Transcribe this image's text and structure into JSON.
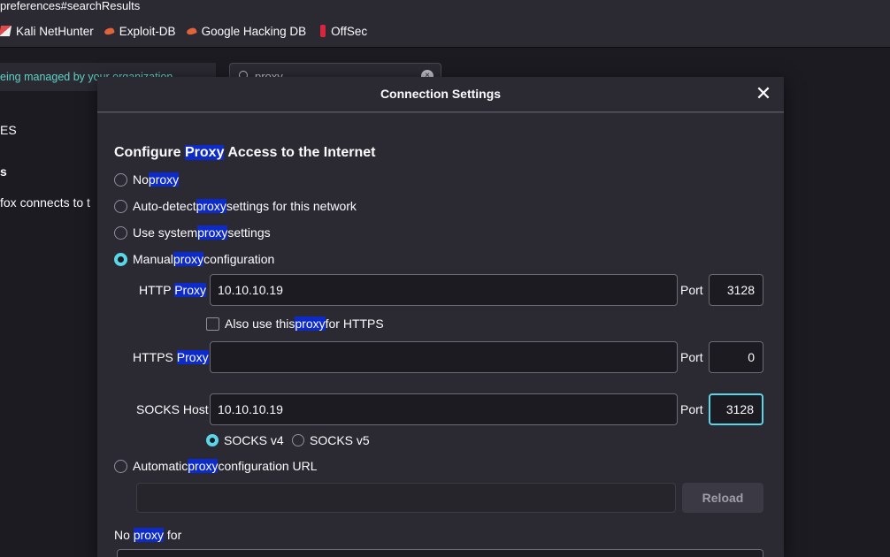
{
  "browser": {
    "url_fragment": "preferences#searchResults",
    "bookmarks": [
      {
        "label": "Kali NetHunter",
        "icon": "kali-icon"
      },
      {
        "label": "Exploit-DB",
        "icon": "exploit-db-icon"
      },
      {
        "label": "Google Hacking DB",
        "icon": "ghdb-icon"
      },
      {
        "label": "OffSec",
        "icon": "offsec-icon"
      }
    ]
  },
  "background": {
    "managed_notice": "eing managed by your organization",
    "search_value": "proxy",
    "side_1": "ES",
    "side_2": "s",
    "side_3": "fox connects to t"
  },
  "dialog": {
    "title": "Connection Settings",
    "heading_pre": "Configure ",
    "heading_hl": "Proxy",
    "heading_post": " Access to the Internet",
    "options": {
      "no_proxy": {
        "pre": "No ",
        "hl": "proxy",
        "post": ""
      },
      "auto_detect": {
        "pre": "Auto-detect ",
        "hl": "proxy",
        "post": " settings for this network"
      },
      "system": {
        "pre": "Use system ",
        "hl": "proxy",
        "post": " settings"
      },
      "manual": {
        "pre": "Manual ",
        "hl": "proxy",
        "post": " configuration"
      },
      "auto_url": {
        "pre": "Automatic ",
        "hl": "proxy",
        "post": " configuration URL"
      }
    },
    "selected_option": "manual",
    "http": {
      "label_pre": "HTTP ",
      "label_hl": "Proxy",
      "value": "10.10.10.19",
      "port_label": "Port",
      "port": "3128"
    },
    "also_https": {
      "pre": "Also use this ",
      "hl": "proxy",
      "post": " for HTTPS",
      "checked": false
    },
    "https": {
      "label_pre": "HTTPS ",
      "label_hl": "Proxy",
      "value": "",
      "port_label": "Port",
      "port": "0"
    },
    "socks": {
      "label": "SOCKS Host",
      "value": "10.10.10.19",
      "port_label": "Port",
      "port": "3128"
    },
    "socks_versions": [
      {
        "label": "SOCKS v4",
        "selected": true
      },
      {
        "label": "SOCKS v5",
        "selected": false
      }
    ],
    "auto_url_value": "",
    "reload_label": "Reload",
    "no_proxy_for": {
      "pre": "No ",
      "hl": "proxy",
      "post": " for"
    }
  },
  "colors": {
    "accent": "#5bd6e9",
    "highlight": "#0d2bc8",
    "dialog_bg": "#2b2a33"
  }
}
